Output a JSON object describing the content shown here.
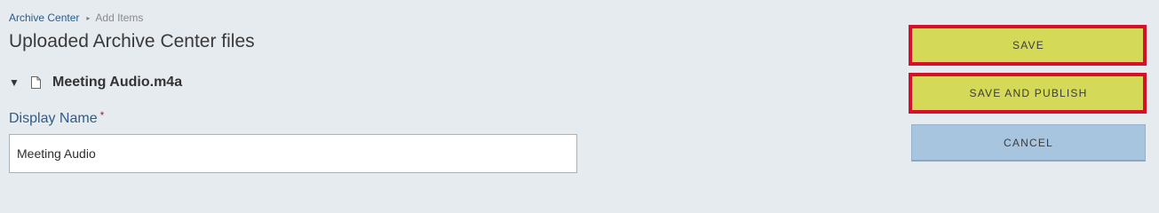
{
  "breadcrumb": {
    "parent": "Archive Center",
    "separator": "▸",
    "current": "Add Items"
  },
  "page": {
    "title": "Uploaded Archive Center files"
  },
  "file": {
    "toggle": "▼",
    "name": "Meeting Audio.m4a"
  },
  "form": {
    "display_name_label": "Display Name",
    "required_marker": "*",
    "display_name_value": "Meeting Audio"
  },
  "actions": {
    "save_label": "SAVE",
    "save_publish_label": "SAVE AND PUBLISH",
    "cancel_label": "CANCEL"
  },
  "colors": {
    "background": "#e6ebf0",
    "primary_button": "#d4d957",
    "cancel_button": "#a8c5e0",
    "highlight": "#d4102a",
    "label": "#2f5b86"
  }
}
